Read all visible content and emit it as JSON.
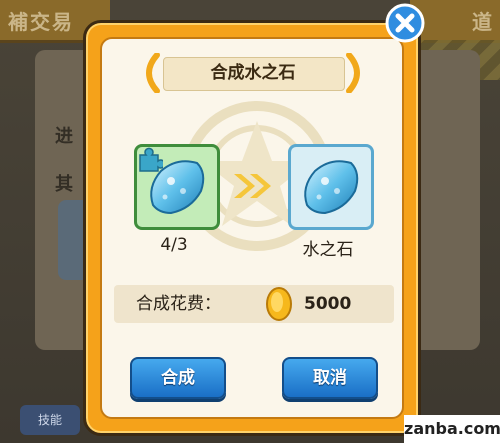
{
  "background": {
    "banner_left": "補交易",
    "banner_right": "道",
    "row1": "进",
    "row2": "其",
    "skill": "技能"
  },
  "dialog": {
    "title": "合成水之石",
    "source_count": "4/3",
    "result_name": "水之石",
    "cost_label": "合成花费：",
    "cost_value": "5000",
    "confirm_label": "合成",
    "cancel_label": "取消"
  },
  "icons": {
    "close": "close-icon",
    "coin": "gold-coin-icon",
    "arrow": "double-chevron-right-icon",
    "puzzle": "puzzle-piece-icon",
    "gem": "water-stone-gem-icon"
  },
  "colors": {
    "dialog_frame": "#f5a21a",
    "button_blue": "#1a6fc6",
    "source_slot": "#3f8d3c",
    "result_slot": "#5aa8cf"
  },
  "watermark": "zanba.com"
}
